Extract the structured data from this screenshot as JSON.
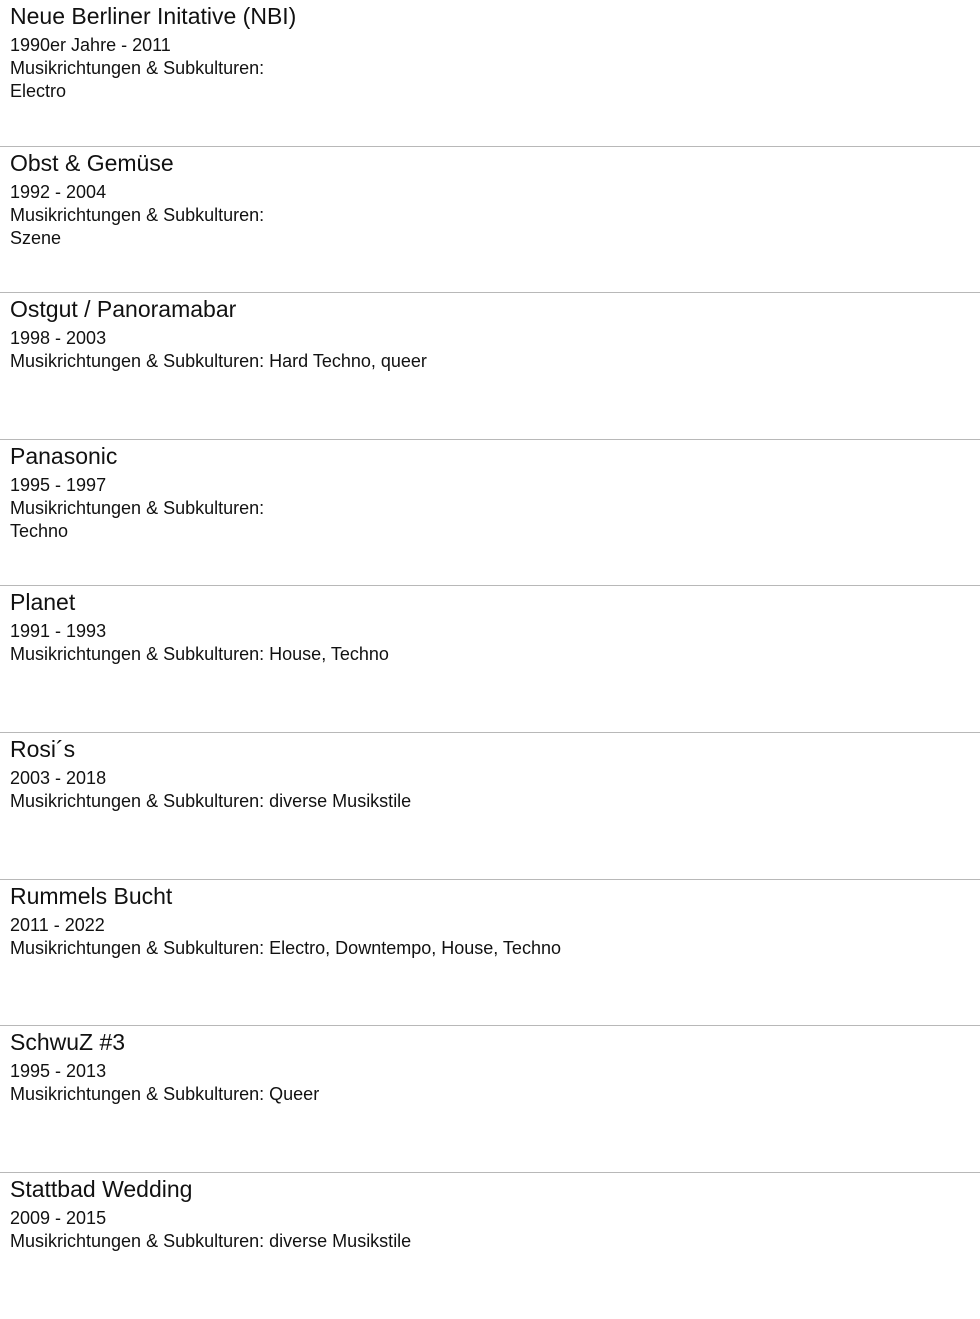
{
  "label_prefix": "Musikrichtungen & Subkulturen:",
  "clubs": [
    {
      "name": "Neue Berliner Initative (NBI)",
      "years": "1990er Jahre - 2011",
      "genres": "Electro",
      "genres_wrapped": true
    },
    {
      "name": "Obst & Gemüse",
      "years": "1992 - 2004",
      "genres": "Szene",
      "genres_wrapped": true
    },
    {
      "name": "Ostgut / Panoramabar",
      "years": "1998 - 2003",
      "genres": "Hard Techno, queer",
      "genres_wrapped": false
    },
    {
      "name": "Panasonic",
      "years": "1995 - 1997",
      "genres": "Techno",
      "genres_wrapped": true
    },
    {
      "name": "Planet",
      "years": "1991 - 1993",
      "genres": "House, Techno",
      "genres_wrapped": false
    },
    {
      "name": "Rosi´s",
      "years": "2003 - 2018",
      "genres": "diverse Musikstile",
      "genres_wrapped": false
    },
    {
      "name": "Rummels Bucht",
      "years": "2011 - 2022",
      "genres": "Electro, Downtempo, House, Techno",
      "genres_wrapped": false
    },
    {
      "name": "SchwuZ #3",
      "years": "1995 - 2013",
      "genres": "Queer",
      "genres_wrapped": false
    },
    {
      "name": "Stattbad Wedding",
      "years": "2009 - 2015",
      "genres": "diverse Musikstile",
      "genres_wrapped": false
    }
  ]
}
